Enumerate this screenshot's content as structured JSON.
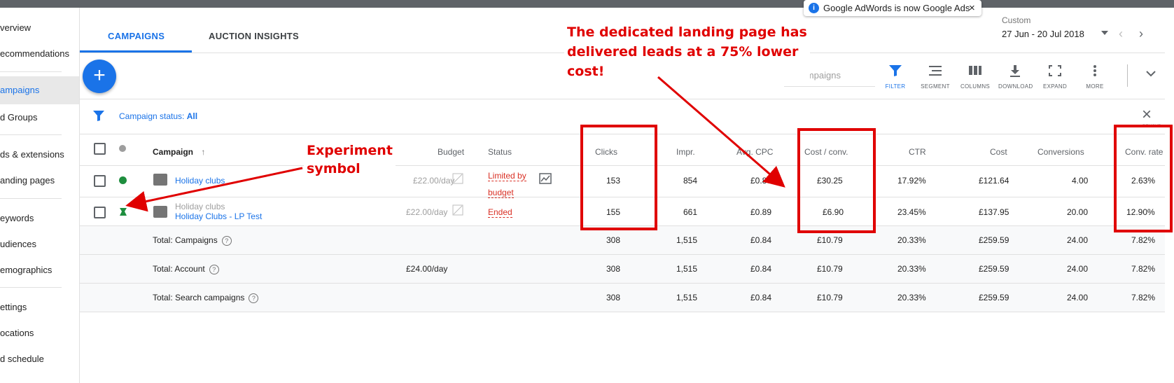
{
  "toast": {
    "info_icon": "info-icon",
    "text": "Google AdWords is now Google Ads",
    "close": "×"
  },
  "sidebar": {
    "items": [
      {
        "label": "verview"
      },
      {
        "label": "ecommendations"
      },
      {
        "label": "ampaigns"
      },
      {
        "label": "d Groups"
      },
      {
        "label": "ds & extensions"
      },
      {
        "label": "anding pages"
      },
      {
        "label": "eywords"
      },
      {
        "label": "udiences"
      },
      {
        "label": "emographics"
      },
      {
        "label": "ettings"
      },
      {
        "label": "ocations"
      },
      {
        "label": "d schedule"
      }
    ]
  },
  "tabs": [
    {
      "label": "CAMPAIGNS"
    },
    {
      "label": "AUCTION INSIGHTS"
    }
  ],
  "date": {
    "label": "Custom",
    "range": "27 Jun - 20 Jul 2018"
  },
  "toolbar": {
    "search_placeholder": "nd campaigns",
    "filter": "FILTER",
    "segment": "SEGMENT",
    "columns": "COLUMNS",
    "download": "DOWNLOAD",
    "expand": "EXPAND",
    "more": "MORE"
  },
  "filter_bar": {
    "label": "Campaign status:",
    "value": "All",
    "remove": "REMOVE"
  },
  "table": {
    "headers": {
      "campaign": "Campaign",
      "budget": "Budget",
      "status": "Status",
      "clicks": "Clicks",
      "impr": "Impr.",
      "avg_cpc": "Avg. CPC",
      "cost_conv": "Cost / conv.",
      "ctr": "CTR",
      "cost": "Cost",
      "conversions": "Conversions",
      "conv_rate": "Conv. rate"
    },
    "rows": [
      {
        "campaign": "Holiday clubs",
        "budget": "£22.00/day",
        "status_line1": "Limited by",
        "status_line2": "budget",
        "clicks": "153",
        "impr": "854",
        "avg_cpc": "£0.80",
        "cost_conv": "£30.25",
        "ctr": "17.92%",
        "cost": "£121.64",
        "conversions": "4.00",
        "conv_rate": "2.63%"
      },
      {
        "campaign_parent": "Holiday clubs",
        "campaign": "Holiday Clubs - LP Test",
        "budget": "£22.00/day",
        "status_line1": "Ended",
        "clicks": "155",
        "impr": "661",
        "avg_cpc": "£0.89",
        "cost_conv": "£6.90",
        "ctr": "23.45%",
        "cost": "£137.95",
        "conversions": "20.00",
        "conv_rate": "12.90%"
      }
    ],
    "totals": [
      {
        "label": "Total: Campaigns",
        "budget": "",
        "clicks": "308",
        "impr": "1,515",
        "avg_cpc": "£0.84",
        "cost_conv": "£10.79",
        "ctr": "20.33%",
        "cost": "£259.59",
        "conversions": "24.00",
        "conv_rate": "7.82%"
      },
      {
        "label": "Total: Account",
        "budget": "£24.00/day",
        "clicks": "308",
        "impr": "1,515",
        "avg_cpc": "£0.84",
        "cost_conv": "£10.79",
        "ctr": "20.33%",
        "cost": "£259.59",
        "conversions": "24.00",
        "conv_rate": "7.82%"
      },
      {
        "label": "Total: Search campaigns",
        "budget": "",
        "clicks": "308",
        "impr": "1,515",
        "avg_cpc": "£0.84",
        "cost_conv": "£10.79",
        "ctr": "20.33%",
        "cost": "£259.59",
        "conversions": "24.00",
        "conv_rate": "7.82%"
      }
    ]
  },
  "annotations": {
    "headline_1": "The dedicated landing page has",
    "headline_2": "delivered leads at a 75% lower",
    "headline_3": "cost!",
    "experiment_1": "Experiment",
    "experiment_2": "symbol"
  },
  "colors": {
    "accent": "#1a73e8",
    "annotation_red": "#e00000",
    "enabled_green": "#1e8e3e"
  }
}
